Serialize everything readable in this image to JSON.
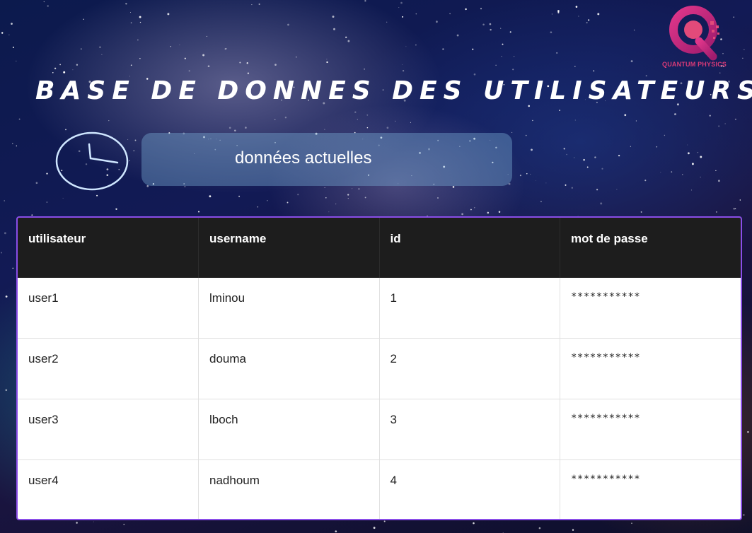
{
  "logo": {
    "caption": "QUANTUM PHYSICS",
    "colors": {
      "primary": "#c8207a",
      "secondary": "#ef4a6a"
    }
  },
  "page_title": "BASE DE DONNES DES UTILISATEURS",
  "clock_icon": "clock-icon",
  "current_data_label": "données actuelles",
  "table": {
    "headers": [
      "utilisateur",
      "username",
      "id",
      "mot de passe"
    ],
    "rows": [
      {
        "utilisateur": "user1",
        "username": "lminou",
        "id": "1",
        "password": "***********"
      },
      {
        "utilisateur": "user2",
        "username": "douma",
        "id": "2",
        "password": "***********"
      },
      {
        "utilisateur": "user3",
        "username": "lboch",
        "id": "3",
        "password": "***********"
      },
      {
        "utilisateur": "user4",
        "username": "nadhoum",
        "id": "4",
        "password": "***********"
      }
    ]
  },
  "colors": {
    "table_border": "#8a4de8",
    "header_bg": "#1d1d1d",
    "pill_bg": "rgba(120,170,210,0.42)"
  }
}
